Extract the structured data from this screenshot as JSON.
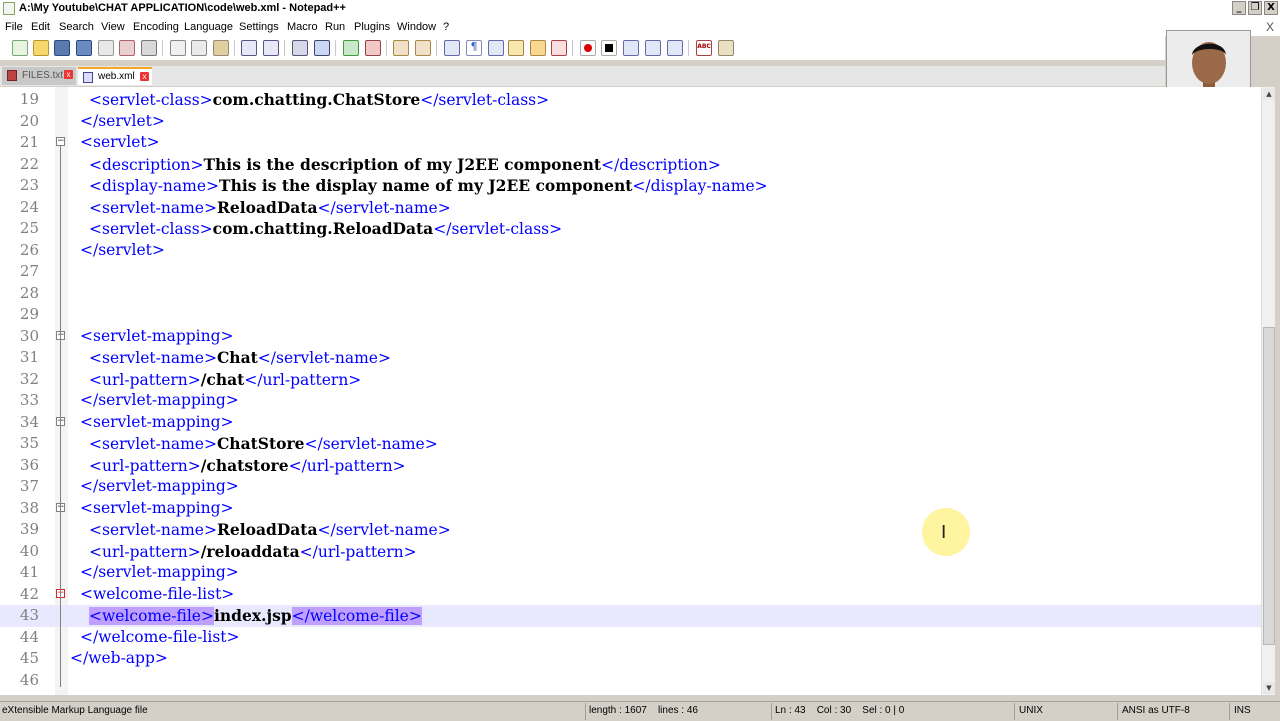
{
  "window": {
    "title": "A:\\My Youtube\\CHAT APPLICATION\\code\\web.xml - Notepad++",
    "buttons": [
      "_",
      "❐",
      "X"
    ]
  },
  "menu": {
    "items": [
      "File",
      "Edit",
      "Search",
      "View",
      "Encoding",
      "Language",
      "Settings",
      "Macro",
      "Run",
      "Plugins",
      "Window",
      "?"
    ],
    "close_doc": "X"
  },
  "tabs": [
    {
      "label": "FILES.txt",
      "active": false
    },
    {
      "label": "web.xml",
      "active": true
    }
  ],
  "editor": {
    "current_line": 43,
    "lines": [
      {
        "n": 19,
        "indent": 2,
        "fold": "",
        "parts": [
          [
            "t",
            "<servlet-class>"
          ],
          [
            "x",
            "com.chatting.ChatStore"
          ],
          [
            "t",
            "</servlet-class>"
          ]
        ]
      },
      {
        "n": 20,
        "indent": 1,
        "fold": "",
        "parts": [
          [
            "t",
            "</servlet>"
          ]
        ]
      },
      {
        "n": 21,
        "indent": 1,
        "fold": "box",
        "parts": [
          [
            "t",
            "<servlet>"
          ]
        ]
      },
      {
        "n": 22,
        "indent": 2,
        "fold": "",
        "parts": [
          [
            "t",
            "<description>"
          ],
          [
            "x",
            "This is the description of my J2EE component"
          ],
          [
            "t",
            "</description>"
          ]
        ]
      },
      {
        "n": 23,
        "indent": 2,
        "fold": "",
        "parts": [
          [
            "t",
            "<display-name>"
          ],
          [
            "x",
            "This is the display name of my J2EE component"
          ],
          [
            "t",
            "</display-name>"
          ]
        ]
      },
      {
        "n": 24,
        "indent": 2,
        "fold": "",
        "parts": [
          [
            "t",
            "<servlet-name>"
          ],
          [
            "x",
            "ReloadData"
          ],
          [
            "t",
            "</servlet-name>"
          ]
        ]
      },
      {
        "n": 25,
        "indent": 2,
        "fold": "",
        "parts": [
          [
            "t",
            "<servlet-class>"
          ],
          [
            "x",
            "com.chatting.ReloadData"
          ],
          [
            "t",
            "</servlet-class>"
          ]
        ]
      },
      {
        "n": 26,
        "indent": 1,
        "fold": "",
        "parts": [
          [
            "t",
            "</servlet>"
          ]
        ]
      },
      {
        "n": 27,
        "indent": 0,
        "fold": "",
        "parts": []
      },
      {
        "n": 28,
        "indent": 0,
        "fold": "",
        "parts": []
      },
      {
        "n": 29,
        "indent": 0,
        "fold": "",
        "parts": []
      },
      {
        "n": 30,
        "indent": 1,
        "fold": "box",
        "parts": [
          [
            "t",
            "<servlet-mapping>"
          ]
        ]
      },
      {
        "n": 31,
        "indent": 2,
        "fold": "",
        "parts": [
          [
            "t",
            "<servlet-name>"
          ],
          [
            "x",
            "Chat"
          ],
          [
            "t",
            "</servlet-name>"
          ]
        ]
      },
      {
        "n": 32,
        "indent": 2,
        "fold": "",
        "parts": [
          [
            "t",
            "<url-pattern>"
          ],
          [
            "x",
            "/chat"
          ],
          [
            "t",
            "</url-pattern>"
          ]
        ]
      },
      {
        "n": 33,
        "indent": 1,
        "fold": "",
        "parts": [
          [
            "t",
            "</servlet-mapping>"
          ]
        ]
      },
      {
        "n": 34,
        "indent": 1,
        "fold": "box",
        "parts": [
          [
            "t",
            "<servlet-mapping>"
          ]
        ]
      },
      {
        "n": 35,
        "indent": 2,
        "fold": "",
        "parts": [
          [
            "t",
            "<servlet-name>"
          ],
          [
            "x",
            "ChatStore"
          ],
          [
            "t",
            "</servlet-name>"
          ]
        ]
      },
      {
        "n": 36,
        "indent": 2,
        "fold": "",
        "parts": [
          [
            "t",
            "<url-pattern>"
          ],
          [
            "x",
            "/chatstore"
          ],
          [
            "t",
            "</url-pattern>"
          ]
        ]
      },
      {
        "n": 37,
        "indent": 1,
        "fold": "",
        "parts": [
          [
            "t",
            "</servlet-mapping>"
          ]
        ]
      },
      {
        "n": 38,
        "indent": 1,
        "fold": "box",
        "parts": [
          [
            "t",
            "<servlet-mapping>"
          ]
        ]
      },
      {
        "n": 39,
        "indent": 2,
        "fold": "",
        "parts": [
          [
            "t",
            "<servlet-name>"
          ],
          [
            "x",
            "ReloadData"
          ],
          [
            "t",
            "</servlet-name>"
          ]
        ]
      },
      {
        "n": 40,
        "indent": 2,
        "fold": "",
        "parts": [
          [
            "t",
            "<url-pattern>"
          ],
          [
            "x",
            "/reloaddata"
          ],
          [
            "t",
            "</url-pattern>"
          ]
        ]
      },
      {
        "n": 41,
        "indent": 1,
        "fold": "",
        "parts": [
          [
            "t",
            "</servlet-mapping>"
          ]
        ]
      },
      {
        "n": 42,
        "indent": 1,
        "fold": "red",
        "parts": [
          [
            "t",
            "<welcome-file-list>"
          ]
        ]
      },
      {
        "n": 43,
        "indent": 2,
        "fold": "",
        "parts": [
          [
            "h",
            "<welcome-file>"
          ],
          [
            "x",
            "index.jsp"
          ],
          [
            "h",
            "</welcome-file>"
          ]
        ]
      },
      {
        "n": 44,
        "indent": 1,
        "fold": "",
        "parts": [
          [
            "t",
            "</welcome-file-list>"
          ]
        ]
      },
      {
        "n": 45,
        "indent": 0,
        "fold": "",
        "parts": [
          [
            "t",
            "</web-app>"
          ]
        ]
      },
      {
        "n": 46,
        "indent": 0,
        "fold": "",
        "parts": []
      }
    ]
  },
  "status": {
    "file_type": "eXtensible Markup Language file",
    "length": "length : 1607    lines : 46",
    "position": "Ln : 43    Col : 30    Sel : 0 | 0",
    "eol": "UNIX",
    "encoding": "ANSI as UTF-8",
    "mode": "INS"
  },
  "colors": {
    "tag": "#0000ff",
    "text": "#000000",
    "highlight": "#c0a0ff",
    "current_line": "#e8e8ff",
    "tab_accent": "#f5a623"
  }
}
